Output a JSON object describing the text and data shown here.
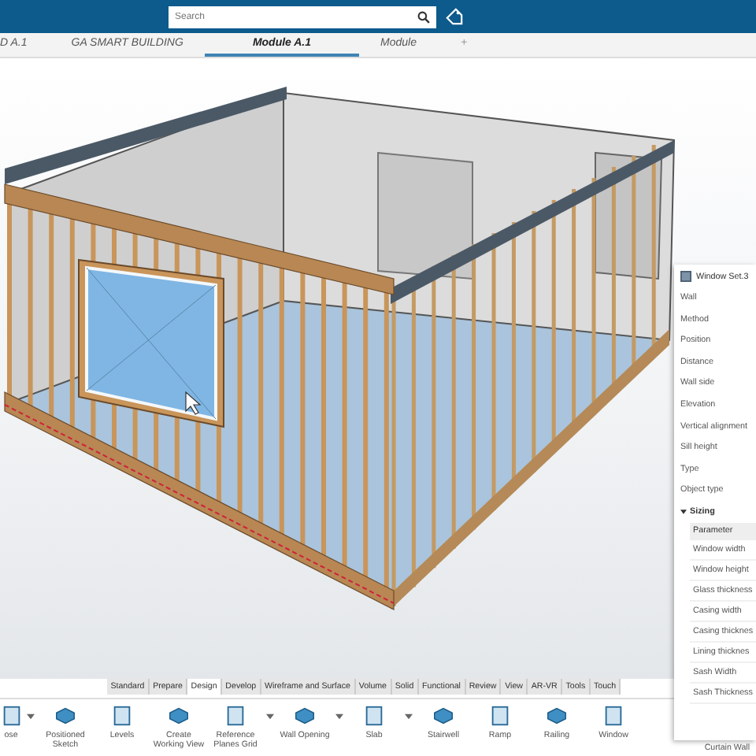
{
  "top_bar": {
    "search": {
      "placeholder": "Search"
    }
  },
  "tabs": [
    {
      "label": "D A.1",
      "selected": false
    },
    {
      "label": "GA SMART BUILDING",
      "selected": false
    },
    {
      "label": "Module A.1",
      "selected": true
    },
    {
      "label": "Module",
      "selected": false
    }
  ],
  "add_tab": "+",
  "toolbar_tabs": [
    {
      "label": "Standard",
      "selected": false
    },
    {
      "label": "Prepare",
      "selected": false
    },
    {
      "label": "Design",
      "selected": true
    },
    {
      "label": "Develop",
      "selected": false
    },
    {
      "label": "Wireframe and Surface",
      "selected": false
    },
    {
      "label": "Volume",
      "selected": false
    },
    {
      "label": "Solid",
      "selected": false
    },
    {
      "label": "Functional",
      "selected": false
    },
    {
      "label": "Review",
      "selected": false
    },
    {
      "label": "View",
      "selected": false
    },
    {
      "label": "AR-VR",
      "selected": false
    },
    {
      "label": "Tools",
      "selected": false
    },
    {
      "label": "Touch",
      "selected": false
    }
  ],
  "tools": [
    {
      "label": "ose",
      "dropdown": true
    },
    {
      "label": "Positioned Sketch",
      "dropdown": false
    },
    {
      "label": "Levels",
      "dropdown": false
    },
    {
      "label": "Create Working View",
      "dropdown": false
    },
    {
      "label": "Reference Planes Grid",
      "dropdown": true
    },
    {
      "label": "Wall Opening",
      "dropdown": true
    },
    {
      "label": "Slab",
      "dropdown": true
    },
    {
      "label": "Stairwell",
      "dropdown": false
    },
    {
      "label": "Ramp",
      "dropdown": false
    },
    {
      "label": "Railing",
      "dropdown": false
    },
    {
      "label": "Window",
      "dropdown": false
    }
  ],
  "hidden_tool_label": "Curtain Wall",
  "panel": {
    "title": "Window Set.3",
    "fields": [
      "Wall",
      "Method",
      "Position",
      "Distance",
      "Wall side",
      "Elevation",
      "Vertical alignment",
      "Sill height",
      "Type",
      "Object type"
    ],
    "section": {
      "label": "Sizing",
      "expanded": true,
      "column": "Parameter",
      "rows": [
        "Window width",
        "Window height",
        "Glass thickness",
        "Casing width",
        "Casing thicknes",
        "Lining thicknes",
        "Sash Width",
        "Sash Thickness"
      ]
    }
  }
}
